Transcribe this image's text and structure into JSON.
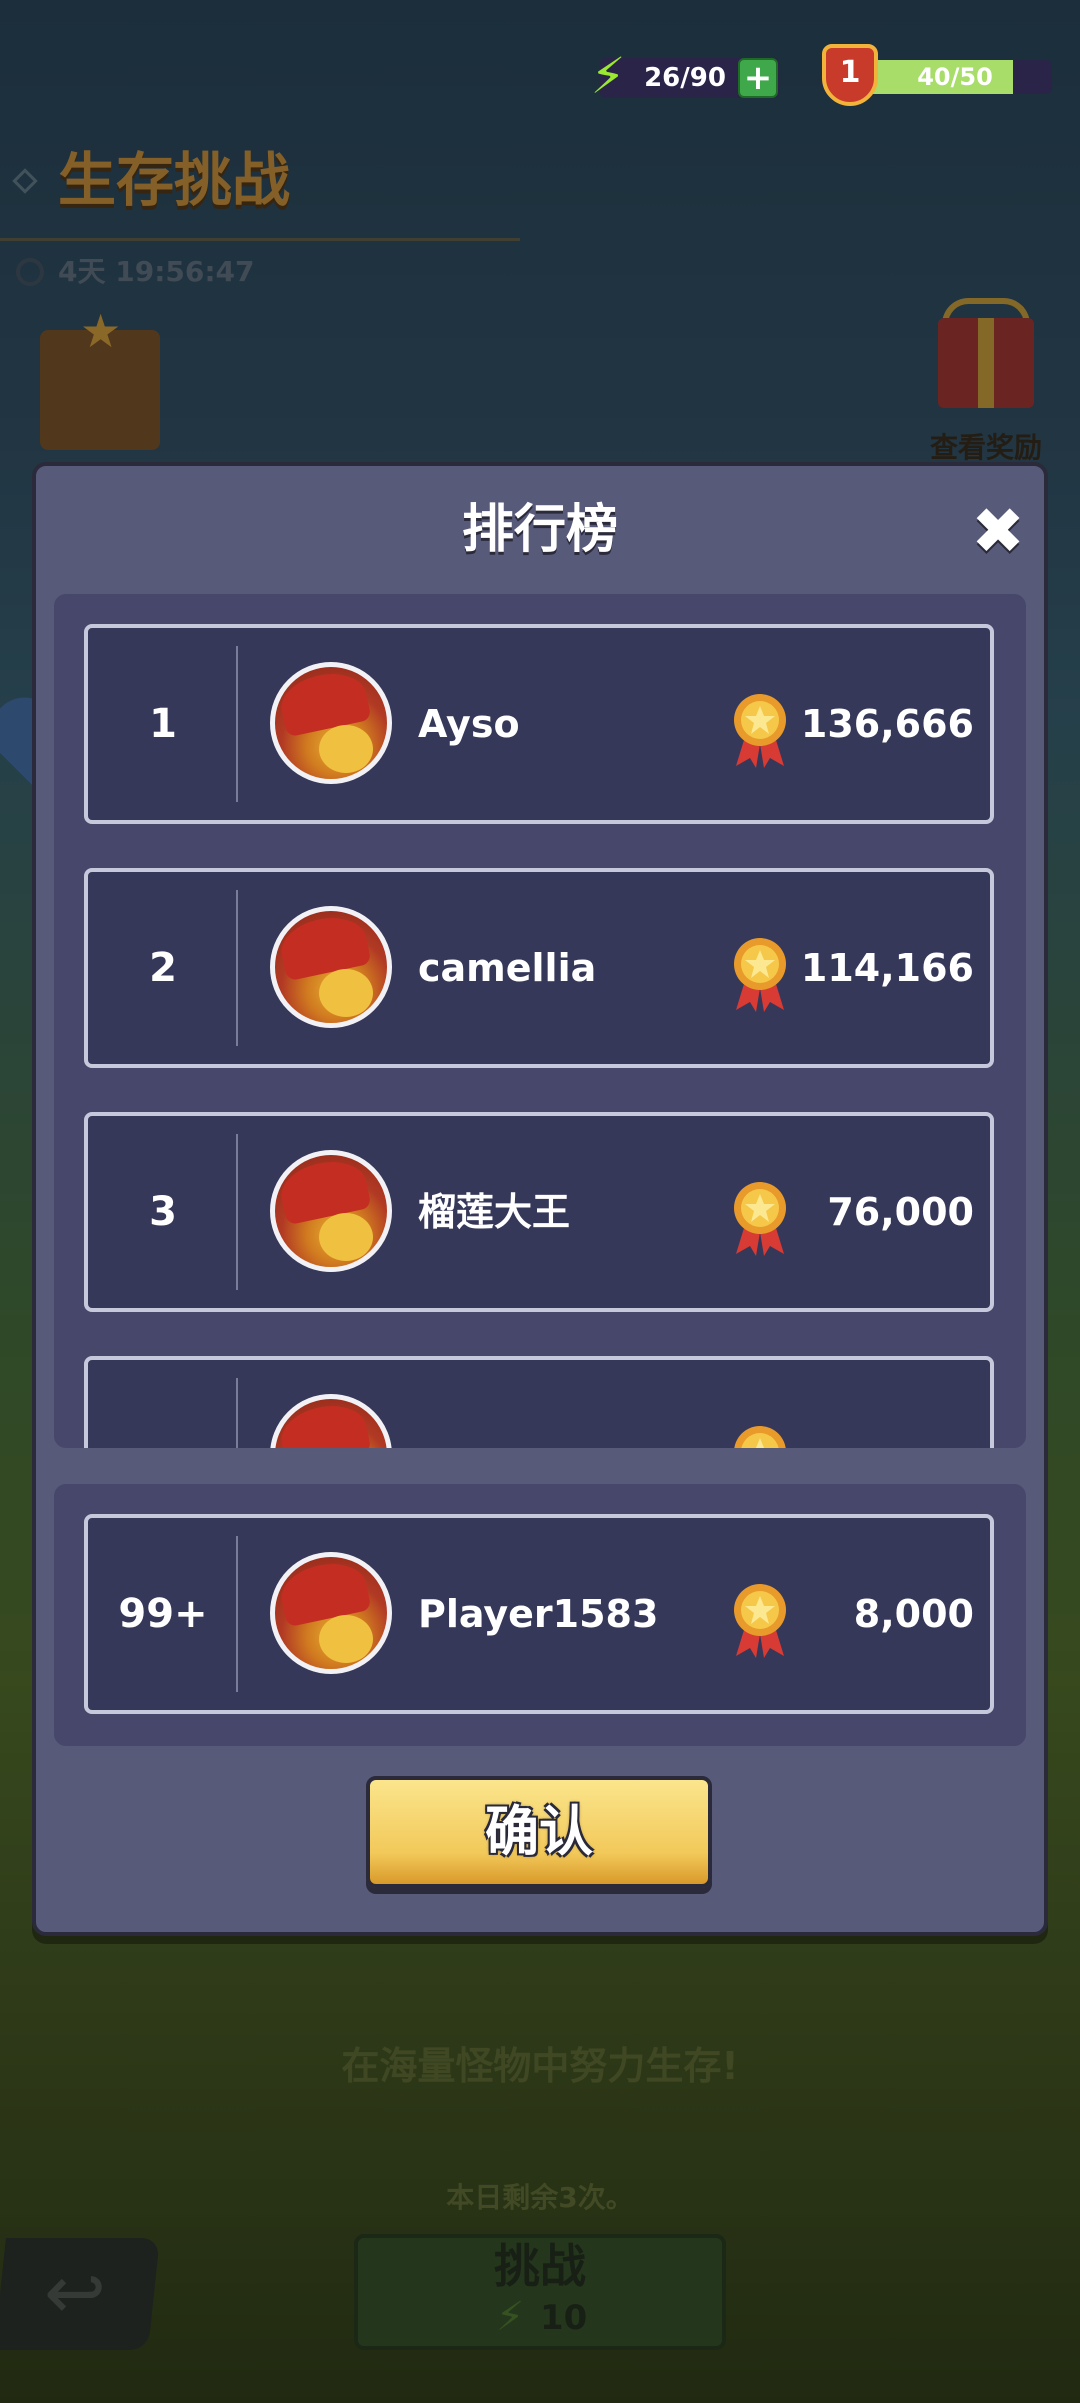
{
  "hud": {
    "energy": "26/90",
    "energy_icon": "lightning-icon",
    "add_icon": "plus-icon",
    "level": "1",
    "xp": "40/50",
    "xp_fraction": 0.8,
    "colors": {
      "energy_green": "#9be830",
      "xp_fill": "#a8dd6a",
      "shield_red": "#c83a2a"
    }
  },
  "background_page": {
    "title": "生存挑战",
    "timer": "4天 19:56:47",
    "reward_label": "查看奖励",
    "motto": "在海量怪物中努力生存!",
    "remaining": "本日剩余3次。",
    "challenge_label": "挑战",
    "challenge_cost": "10"
  },
  "leaderboard": {
    "title": "排行榜",
    "close_icon": "close-icon",
    "rows": [
      {
        "rank": "1",
        "name": "Ayso",
        "score": "136,666"
      },
      {
        "rank": "2",
        "name": "camellia",
        "score": "114,166"
      },
      {
        "rank": "3",
        "name": "榴莲大王",
        "score": "76,000"
      },
      {
        "rank": "",
        "name": "",
        "score": ""
      }
    ],
    "self": {
      "rank": "99+",
      "name": "Player1583",
      "score": "8,000"
    },
    "confirm_label": "确认",
    "medal_icon": "medal-icon",
    "colors": {
      "panel": "#46476a",
      "row": "#36385a",
      "confirm": "#f2c95a"
    }
  }
}
